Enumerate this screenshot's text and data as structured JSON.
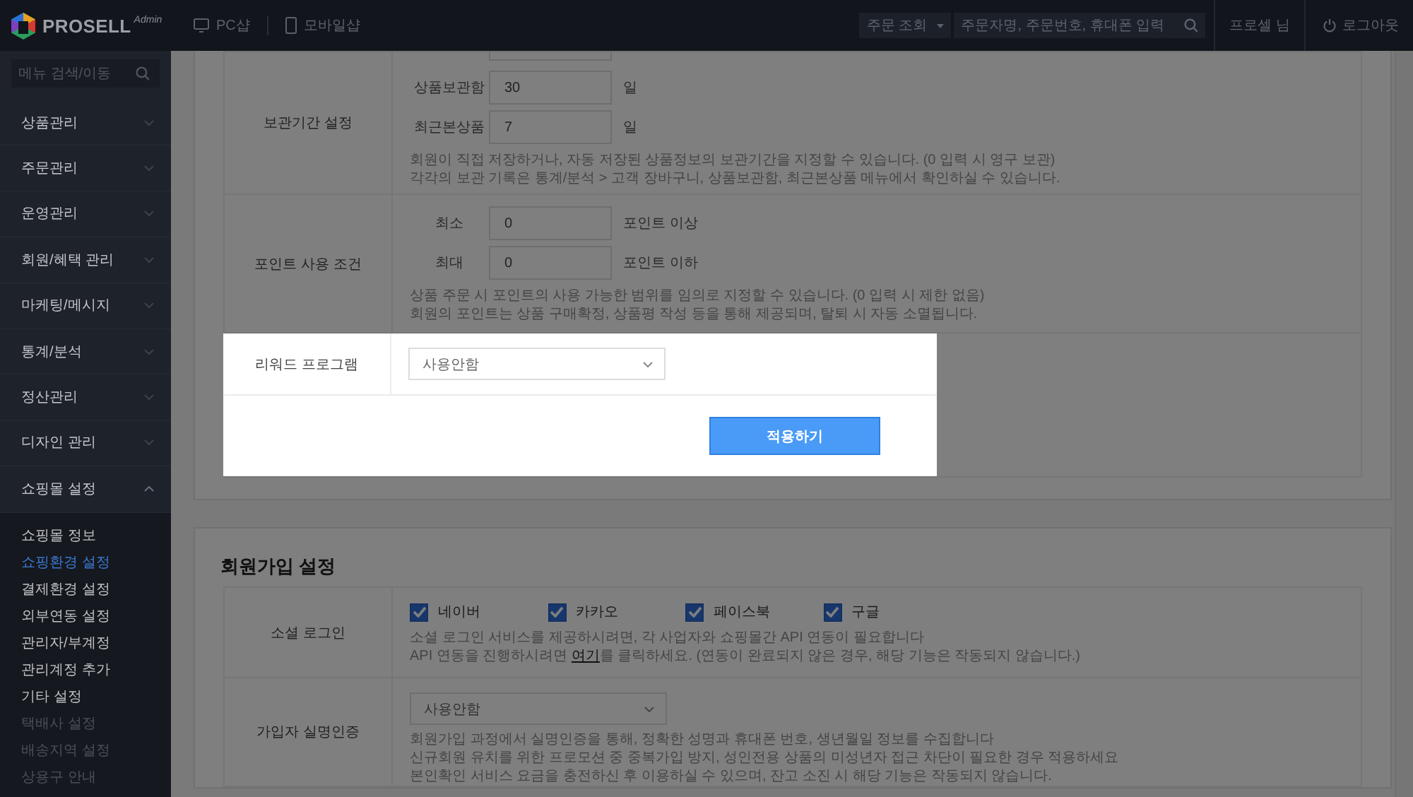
{
  "header": {
    "logo": "PROSELL",
    "logo_sub": "Admin",
    "nav": [
      {
        "label": "PC샵",
        "kind": "pc"
      },
      {
        "label": "모바일샵",
        "kind": "mobile"
      }
    ],
    "search_scope": "주문 조회",
    "search": {
      "placeholder": "주문자명, 주문번호, 휴대폰 입력"
    },
    "user": "프로셀 님",
    "logout": "로그아웃"
  },
  "sidebar": {
    "search": {
      "placeholder": "메뉴 검색/이동"
    },
    "items": [
      {
        "label": "상품관리",
        "expanded": false
      },
      {
        "label": "주문관리",
        "expanded": false
      },
      {
        "label": "운영관리",
        "expanded": false
      },
      {
        "label": "회원/혜택 관리",
        "expanded": false
      },
      {
        "label": "마케팅/메시지",
        "expanded": false
      },
      {
        "label": "통계/분석",
        "expanded": false
      },
      {
        "label": "정산관리",
        "expanded": false
      },
      {
        "label": "디자인 관리",
        "expanded": false
      },
      {
        "label": "쇼핑몰 설정",
        "expanded": true,
        "children": [
          {
            "label": "쇼핑몰 정보",
            "selected": false,
            "disabled": false
          },
          {
            "label": "쇼핑환경 설정",
            "selected": true,
            "disabled": false
          },
          {
            "label": "결제환경 설정",
            "selected": false,
            "disabled": false
          },
          {
            "label": "외부연동 설정",
            "selected": false,
            "disabled": false
          },
          {
            "label": "관리자/부계정",
            "selected": false,
            "disabled": false
          },
          {
            "label": "관리계정 추가",
            "selected": false,
            "disabled": false
          },
          {
            "label": "기타 설정",
            "selected": false,
            "disabled": false
          },
          {
            "label": "택배사 설정",
            "selected": false,
            "disabled": true
          },
          {
            "label": "배송지역 설정",
            "selected": false,
            "disabled": true
          },
          {
            "label": "상용구 안내",
            "selected": false,
            "disabled": true
          }
        ]
      }
    ]
  },
  "retention": {
    "label": "보관기간 설정",
    "fields": [
      {
        "label": "상품보관함",
        "value": "30",
        "unit": "일"
      },
      {
        "label": "최근본상품",
        "value": "7",
        "unit": "일"
      }
    ],
    "notes": [
      "회원이 직접 저장하거나, 자동 저장된 상품정보의 보관기간을 지정할 수 있습니다. (0 입력 시 영구 보관)",
      "각각의 보관 기록은 통계/분석 > 고객 장바구니, 상품보관함, 최근본상품 메뉴에서 확인하실 수 있습니다."
    ]
  },
  "points": {
    "label": "포인트 사용 조건",
    "fields": [
      {
        "label": "최소",
        "value": "0",
        "unit": "포인트 이상"
      },
      {
        "label": "최대",
        "value": "0",
        "unit": "포인트 이하"
      }
    ],
    "notes": [
      "상품 주문 시 포인트의 사용 가능한 범위를 임의로 지정할 수 있습니다. (0 입력 시 제한 없음)",
      "회원의 포인트는 상품 구매확정, 상품평 작성 등을 통해 제공되며, 탈퇴 시 자동 소멸됩니다."
    ]
  },
  "reward": {
    "label": "리워드 프로그램",
    "select": "사용안함",
    "button": "적용하기"
  },
  "signup": {
    "title": "회원가입 설정",
    "social": {
      "label": "소셜 로그인",
      "options": [
        {
          "label": "네이버",
          "checked": true
        },
        {
          "label": "카카오",
          "checked": true
        },
        {
          "label": "페이스북",
          "checked": true
        },
        {
          "label": "구글",
          "checked": true
        }
      ],
      "notes": [
        {
          "kind": "text",
          "text": "소셜 로그인 서비스를 제공하시려면, 각 사업자와 쇼핑몰간 API 연동이 필요합니다"
        },
        {
          "kind": "link",
          "before": "API 연동을 진행하시려면 ",
          "link": "여기",
          "after": "를 클릭하세요. (연동이 완료되지 않은 경우, 해당 기능은 작동되지 않습니다.)"
        }
      ]
    },
    "verification": {
      "label": "가입자 실명인증",
      "select": "사용안함",
      "notes": [
        "회원가입 과정에서 실명인증을 통해, 정확한 성명과 휴대폰 번호, 생년월일 정보를 수집합니다",
        "신규회원 유치를 위한 프로모션 중 중복가입 방지, 성인전용 상품의 미성년자 접근 차단이 필요한 경우 적용하세요",
        "본인확인 서비스 요금을 충전하신 후 이용하실 수 있으며, 잔고 소진 시 해당 기능은 작동되지 않습니다."
      ]
    }
  }
}
